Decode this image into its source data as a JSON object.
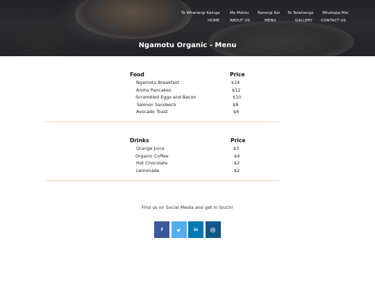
{
  "nav": {
    "top": [
      "Te Wharangi Kainga",
      "Mo Matou",
      "Rarangi Kai",
      "Te Taiwhanga",
      "Whakapa Mai"
    ],
    "sub": [
      "HOME",
      "ABOUT US",
      "MENU",
      "GALLERY",
      "CONTACT US"
    ]
  },
  "page_title": "Ngamotu Organic - Menu",
  "food": {
    "heading": "Food",
    "price_heading": "Price",
    "items": [
      {
        "name": "Ngamotu Breakfast",
        "price": "$14"
      },
      {
        "name": "Aroha Pancakes",
        "price": "$12"
      },
      {
        "name": "Scrambled Eggs and Bacon",
        "price": "$10"
      },
      {
        "name": "Salmon Sandwich",
        "price": "$8"
      },
      {
        "name": "Avocado Toast",
        "price": "$6"
      }
    ]
  },
  "drinks": {
    "heading": "Drinks",
    "price_heading": "Price",
    "items": [
      {
        "name": "Orange Juice",
        "price": "$3"
      },
      {
        "name": "Organic Coffee",
        "price": "$4"
      },
      {
        "name": "Hot Chocolate",
        "price": "$2"
      },
      {
        "name": "Lemonade",
        "price": "$2"
      }
    ]
  },
  "social": {
    "text": "Find us on Social Media and get in touch!",
    "buttons": [
      {
        "icon": "facebook-icon",
        "color": "#3b5998",
        "glyph": "f"
      },
      {
        "icon": "twitter-icon",
        "color": "#55acee",
        "glyph": "t"
      },
      {
        "icon": "linkedin-icon",
        "color": "#0077b5",
        "glyph": "in"
      },
      {
        "icon": "instagram-icon",
        "color": "#125688",
        "glyph": "ig"
      }
    ]
  },
  "colors": {
    "divider": "#f1d2b6",
    "title_text": "#ffffff"
  }
}
